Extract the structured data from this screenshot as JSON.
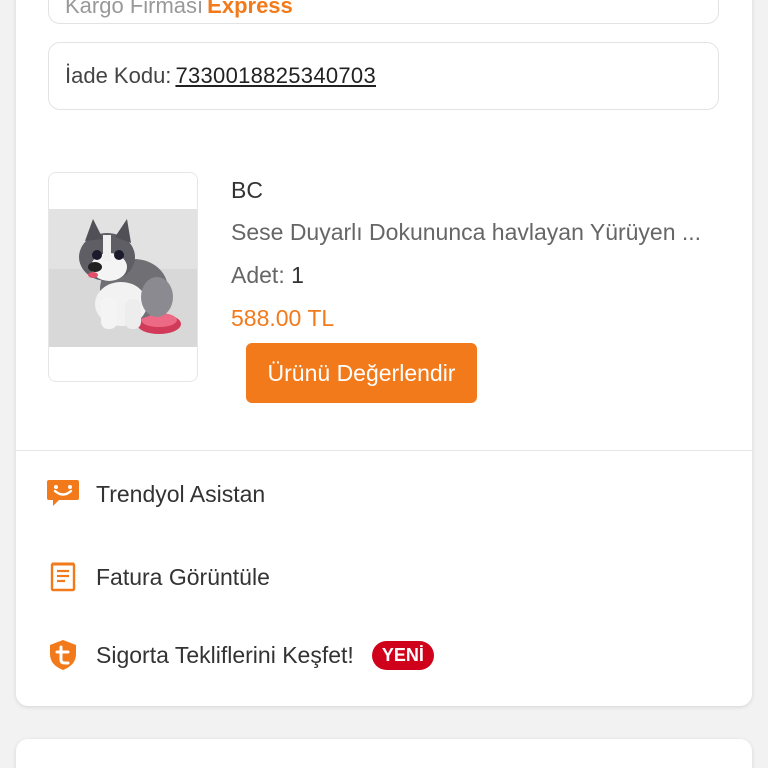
{
  "colors": {
    "accent": "#f27a1a",
    "badge_red": "#d0021b",
    "card_bg": "#ffffff",
    "page_bg": "#f2f2f2"
  },
  "cargo": {
    "partial_text": "Kargo Firması",
    "express_label": "Express"
  },
  "return_code": {
    "label": "İade Kodu:",
    "value": "7330018825340703"
  },
  "product": {
    "image_icon": "plush-husky-dog-image",
    "brand": "BC",
    "name": "Sese Duyarlı Dokununca havlayan Yürüyen ...",
    "quantity_label": "Adet:",
    "quantity_value": "1",
    "price": "588.00 TL",
    "rate_button": "Ürünü Değerlendir"
  },
  "menu": [
    {
      "icon": "chat-assistant-icon",
      "label": "Trendyol Asistan"
    },
    {
      "icon": "invoice-icon",
      "label": "Fatura Görüntüle"
    },
    {
      "icon": "shield-t-icon",
      "label": "Sigorta Tekliflerini Keşfet!",
      "badge": "YENİ"
    }
  ]
}
